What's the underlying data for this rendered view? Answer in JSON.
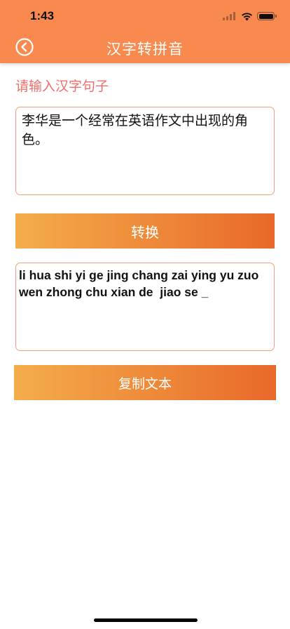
{
  "status_bar": {
    "time": "1:43"
  },
  "nav": {
    "title": "汉字转拼音",
    "back_icon": "back-circle-chevron-icon"
  },
  "form": {
    "prompt_label": "请输入汉字句子",
    "input_value": "李华是一个经常在英语作文中出现的角色。",
    "convert_label": "转换",
    "output_value": "li hua shi yi ge jing chang zai ying yu zuo wen zhong chu xian de  jiao se _",
    "copy_label": "复制文本"
  },
  "colors": {
    "header": "#f88a4f",
    "prompt": "#f26d6a",
    "button_start": "#f4ad4b",
    "button_end": "#e8692a",
    "border": "#f3a07a"
  }
}
